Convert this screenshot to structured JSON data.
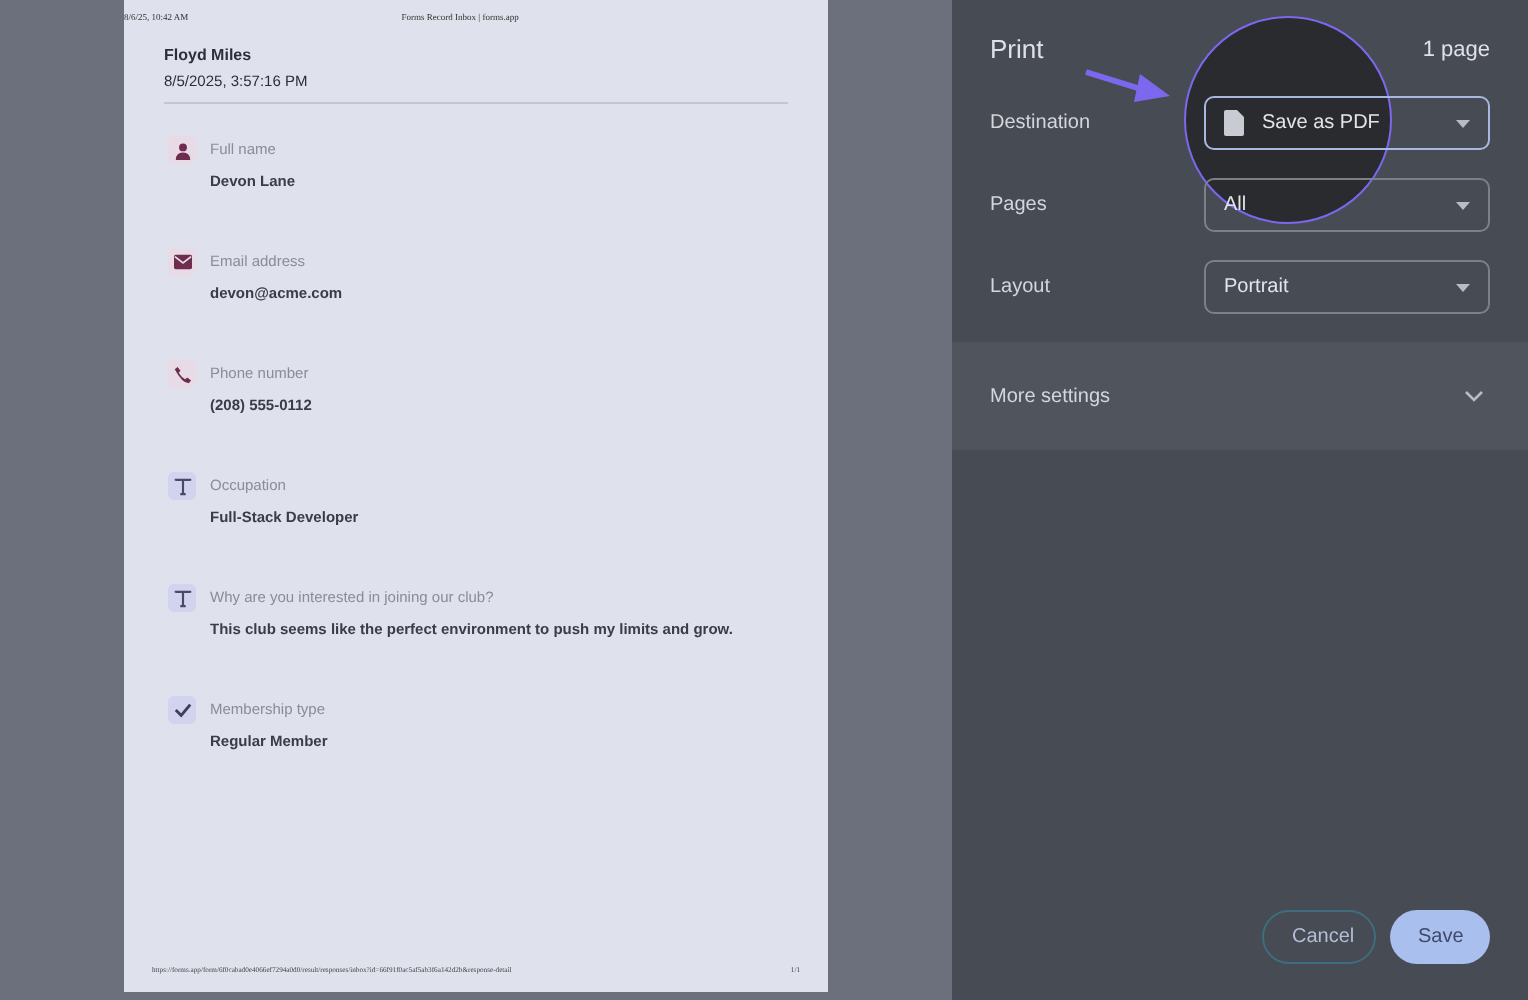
{
  "preview": {
    "header_date": "8/6/25, 10:42 AM",
    "header_title": "Forms Record Inbox | forms.app",
    "respondent": "Floyd Miles",
    "submitted": "8/5/2025, 3:57:16 PM",
    "fields": [
      {
        "kind": "person",
        "label": "Full name",
        "value": "Devon Lane"
      },
      {
        "kind": "mail",
        "label": "Email address",
        "value": "devon@acme.com"
      },
      {
        "kind": "phone",
        "label": "Phone number",
        "value": "(208) 555-0112"
      },
      {
        "kind": "text",
        "label": "Occupation",
        "value": "Full-Stack Developer"
      },
      {
        "kind": "text",
        "label": "Why are you interested in joining our club?",
        "value": "This club seems like the perfect environment to push my limits and grow."
      },
      {
        "kind": "check",
        "label": "Membership type",
        "value": "Regular Member"
      }
    ],
    "footer_url": "https://forms.app/form/6f0cabad0e4066ef7294a0d0/result/responses/inbox?id=66f91f0ac5af5ab3f6a142d2b&response-detail",
    "footer_page": "1/1"
  },
  "print": {
    "title": "Print",
    "page_count": "1 page",
    "settings": [
      {
        "label": "Destination",
        "value": "Save as PDF",
        "highlighted": true
      },
      {
        "label": "Pages",
        "value": "All",
        "highlighted": false
      },
      {
        "label": "Layout",
        "value": "Portrait",
        "highlighted": false
      }
    ],
    "more_settings": "More settings",
    "expanded": false,
    "buttons": [
      {
        "label": "Cancel",
        "kind": "secondary"
      },
      {
        "label": "Save",
        "kind": "primary"
      }
    ]
  }
}
